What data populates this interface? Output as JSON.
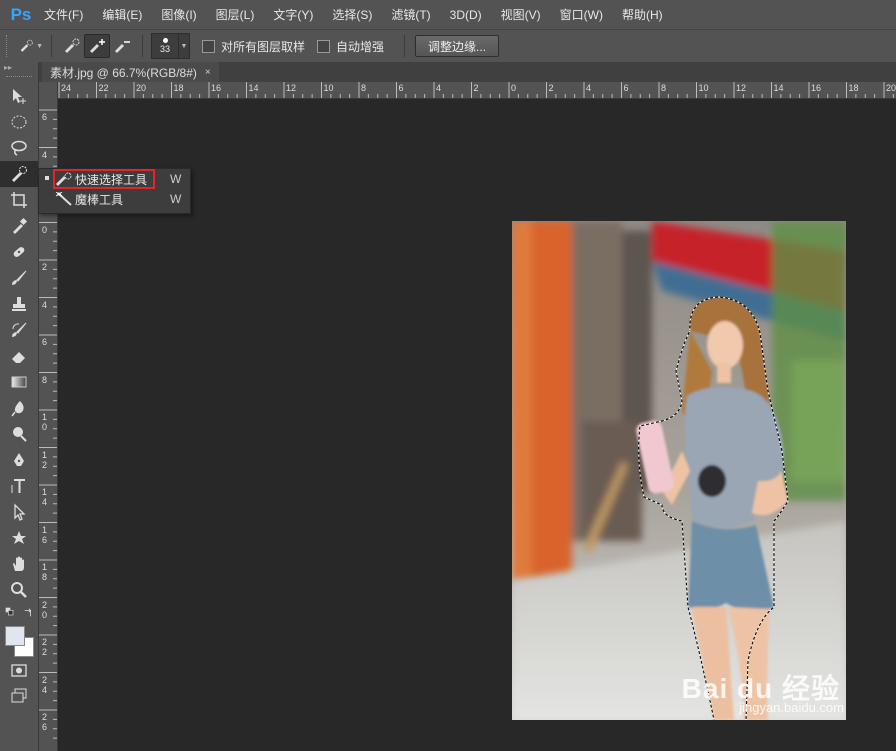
{
  "app": {
    "logo": "Ps"
  },
  "menu": [
    "文件(F)",
    "编辑(E)",
    "图像(I)",
    "图层(L)",
    "文字(Y)",
    "选择(S)",
    "滤镜(T)",
    "3D(D)",
    "视图(V)",
    "窗口(W)",
    "帮助(H)"
  ],
  "options": {
    "brush_size": "33",
    "sample_all_layers": "对所有图层取样",
    "auto_enhance": "自动增强",
    "refine_edge": "调整边缘..."
  },
  "document": {
    "tab_title": "素材.jpg @ 66.7%(RGB/8#)",
    "close": "×"
  },
  "ruler": {
    "horizontal": [
      "24",
      "22",
      "20",
      "18",
      "16",
      "14",
      "12",
      "10",
      "8",
      "6",
      "4",
      "2",
      "0",
      "2",
      "4",
      "6",
      "8",
      "10",
      "12",
      "14",
      "16",
      "18",
      "20"
    ],
    "vertical": [
      "6",
      "4",
      "2",
      "0",
      "2",
      "4",
      "6",
      "8",
      "1\n0",
      "1\n2",
      "1\n4",
      "1\n6",
      "1\n8",
      "2\n0",
      "2\n2",
      "2\n4",
      "2\n6"
    ]
  },
  "flyout": {
    "items": [
      {
        "label": "快速选择工具",
        "shortcut": "W",
        "icon": "quick-selection-icon"
      },
      {
        "label": "魔棒工具",
        "shortcut": "W",
        "icon": "magic-wand-icon"
      }
    ]
  },
  "watermark": {
    "brand": "Bai du 经验",
    "url": "jingyan.baidu.com"
  },
  "colors": {
    "accent": "#31a8ff",
    "highlight": "#e3242b"
  }
}
